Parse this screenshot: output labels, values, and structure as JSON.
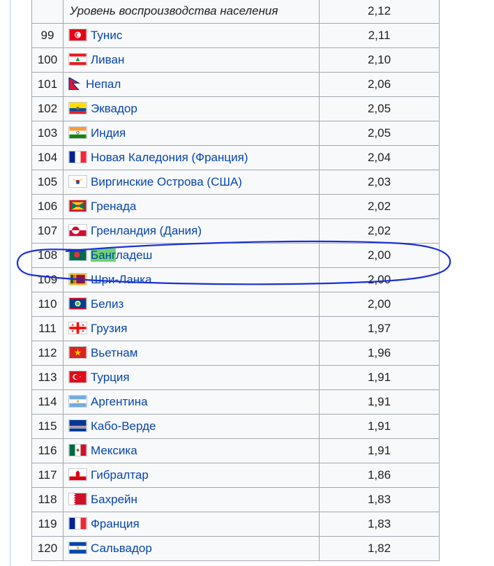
{
  "table": {
    "header_row": {
      "label": "Уровень воспроизводства населения",
      "value": "2,12"
    },
    "rows": [
      {
        "rank": "99",
        "country": "Тунис",
        "value": "2,11",
        "flag": "tunisia-flag"
      },
      {
        "rank": "100",
        "country": "Ливан",
        "value": "2,10",
        "flag": "lebanon-flag"
      },
      {
        "rank": "101",
        "country": "Непал",
        "value": "2,06",
        "flag": "nepal-flag"
      },
      {
        "rank": "102",
        "country": "Эквадор",
        "value": "2,05",
        "flag": "ecuador-flag"
      },
      {
        "rank": "103",
        "country": "Индия",
        "value": "2,05",
        "flag": "india-flag"
      },
      {
        "rank": "104",
        "country": "Новая Каледония (Франция)",
        "value": "2,04",
        "flag": "france-flag"
      },
      {
        "rank": "105",
        "country": "Виргинские Острова (США)",
        "value": "2,03",
        "flag": "usvi-flag"
      },
      {
        "rank": "106",
        "country": "Гренада",
        "value": "2,02",
        "flag": "grenada-flag"
      },
      {
        "rank": "107",
        "country": "Гренландия (Дания)",
        "value": "2,02",
        "flag": "greenland-flag"
      },
      {
        "rank": "108",
        "country_highlight": "Банг",
        "country_rest": "ладеш",
        "value": "2,00",
        "flag": "bangladesh-flag"
      },
      {
        "rank": "109",
        "country": "Шри-Ланка",
        "value": "2,00",
        "flag": "srilanka-flag"
      },
      {
        "rank": "110",
        "country": "Белиз",
        "value": "2,00",
        "flag": "belize-flag"
      },
      {
        "rank": "111",
        "country": "Грузия",
        "value": "1,97",
        "flag": "georgia-flag"
      },
      {
        "rank": "112",
        "country": "Вьетнам",
        "value": "1,96",
        "flag": "vietnam-flag"
      },
      {
        "rank": "113",
        "country": "Турция",
        "value": "1,91",
        "flag": "turkey-flag"
      },
      {
        "rank": "114",
        "country": "Аргентина",
        "value": "1,91",
        "flag": "argentina-flag"
      },
      {
        "rank": "115",
        "country": "Кабо-Верде",
        "value": "1,91",
        "flag": "capeverde-flag"
      },
      {
        "rank": "116",
        "country": "Мексика",
        "value": "1,91",
        "flag": "mexico-flag"
      },
      {
        "rank": "117",
        "country": "Гибралтар",
        "value": "1,86",
        "flag": "gibraltar-flag"
      },
      {
        "rank": "118",
        "country": "Бахрейн",
        "value": "1,83",
        "flag": "bahrain-flag"
      },
      {
        "rank": "119",
        "country": "Франция",
        "value": "1,83",
        "flag": "france-flag"
      },
      {
        "rank": "120",
        "country": "Сальвадор",
        "value": "1,82",
        "flag": "elsalvador-flag"
      }
    ]
  },
  "colors": {
    "link": "#0645ad",
    "highlight": "#6fd36f",
    "annotation_ink": "#1a2fd6",
    "table_border": "#a2a9b1",
    "table_bg": "#f8f9fa"
  }
}
